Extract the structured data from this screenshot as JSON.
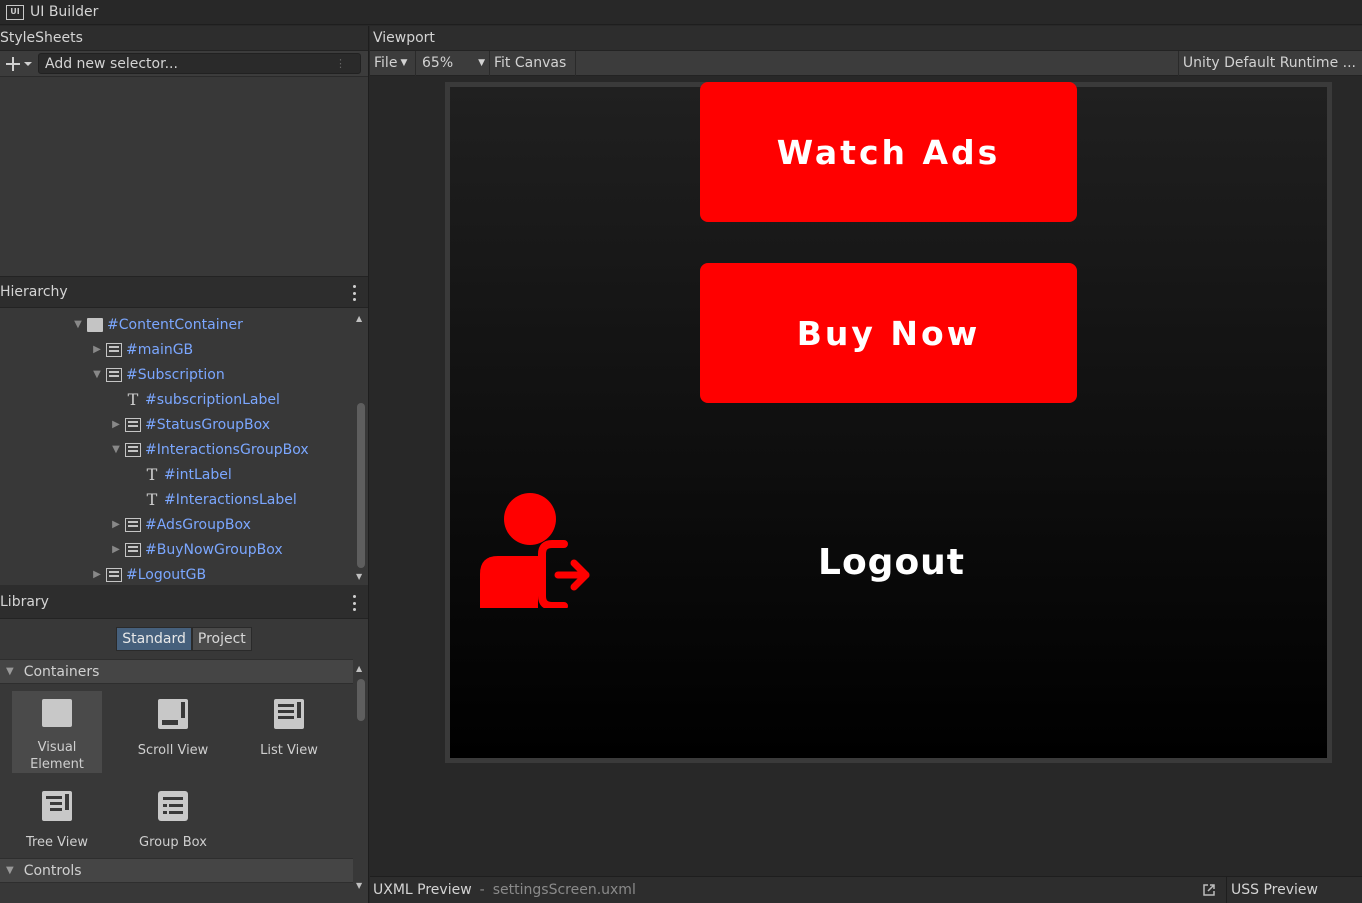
{
  "window": {
    "title": "UI Builder",
    "icon": "UI"
  },
  "stylesheets": {
    "header": "StyleSheets",
    "selector_placeholder": "Add new selector..."
  },
  "hierarchy": {
    "header": "Hierarchy",
    "items": [
      {
        "label": "#ContentContainer",
        "icon": "box-icon",
        "expanded": true
      },
      {
        "label": "#mainGB",
        "icon": "groupbox-icon",
        "expanded": false
      },
      {
        "label": "#Subscription",
        "icon": "groupbox-icon",
        "expanded": true
      },
      {
        "label": "#subscriptionLabel",
        "icon": "text-icon"
      },
      {
        "label": "#StatusGroupBox",
        "icon": "groupbox-icon",
        "expanded": false
      },
      {
        "label": "#InteractionsGroupBox",
        "icon": "groupbox-icon",
        "expanded": true
      },
      {
        "label": "#intLabel",
        "icon": "text-icon"
      },
      {
        "label": "#InteractionsLabel",
        "icon": "text-icon"
      },
      {
        "label": "#AdsGroupBox",
        "icon": "groupbox-icon",
        "expanded": false
      },
      {
        "label": "#BuyNowGroupBox",
        "icon": "groupbox-icon",
        "expanded": false
      },
      {
        "label": "#LogoutGB",
        "icon": "groupbox-icon",
        "expanded": false
      }
    ]
  },
  "library": {
    "header": "Library",
    "tabs": [
      "Standard",
      "Project"
    ],
    "sections": [
      "Containers",
      "Controls"
    ],
    "items": [
      "Visual Element",
      "Scroll View",
      "List View",
      "Tree View",
      "Group Box"
    ]
  },
  "viewport": {
    "header": "Viewport",
    "file_menu": "File",
    "zoom": "65%",
    "fit_canvas": "Fit Canvas",
    "theme": "Unity Default Runtime ...",
    "canvas": {
      "watch_ads": "Watch Ads",
      "buy_now": "Buy Now",
      "logout": "Logout",
      "accent": "#ff0000"
    }
  },
  "bottom": {
    "uxml_label": "UXML Preview",
    "uxml_file": "settingsScreen.uxml",
    "uss_label": "USS Preview"
  }
}
